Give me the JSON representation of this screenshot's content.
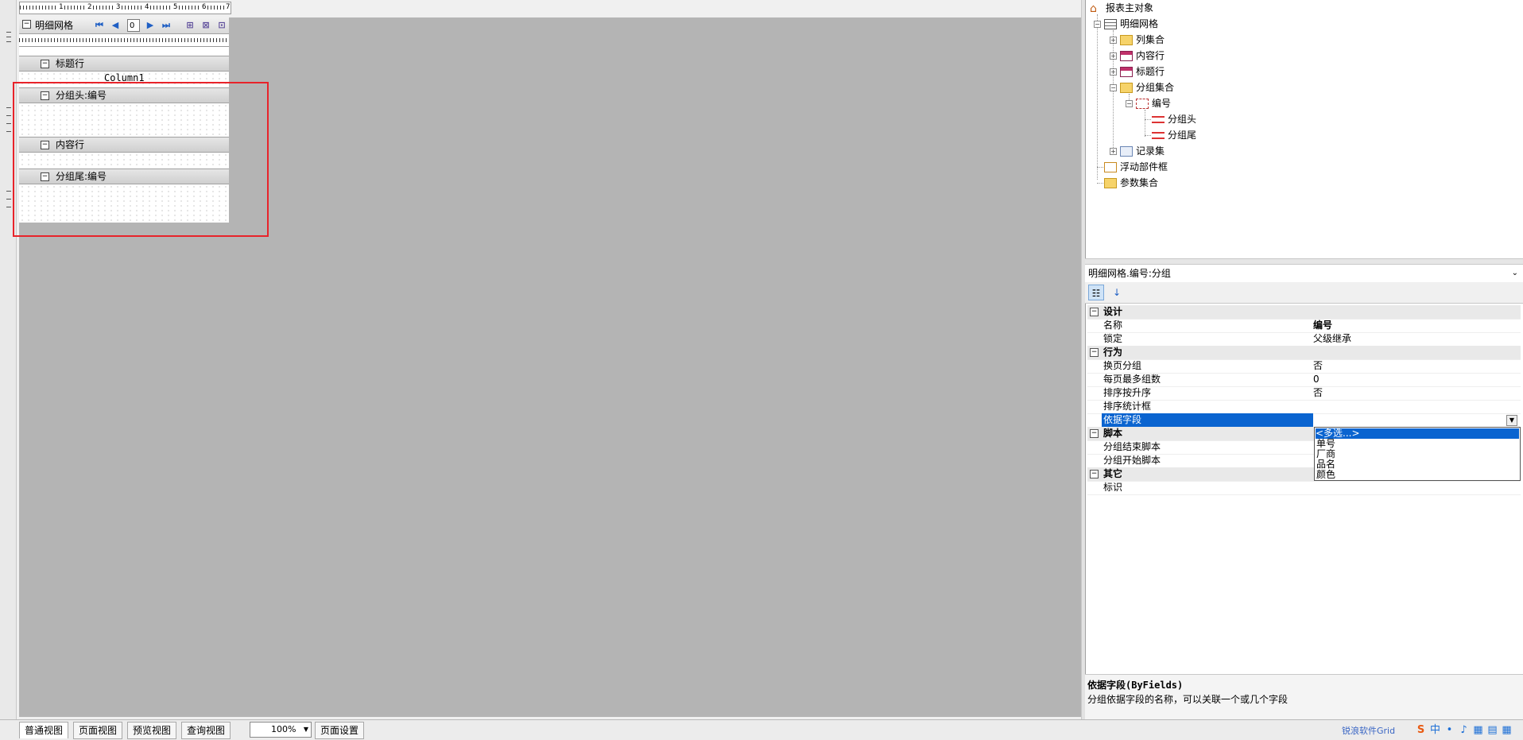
{
  "designer": {
    "ruler_numbers": [
      "1",
      "2",
      "3",
      "4",
      "5",
      "6",
      "7"
    ],
    "grid_toolbar": {
      "title": "明细网格",
      "page_value": "0",
      "collapse_glyph": "⊟",
      "nav_icons": [
        "first-page-icon",
        "prev-page-icon",
        "next-page-icon",
        "last-page-icon"
      ],
      "tool_icons": [
        "grid-tool-icon-1",
        "grid-tool-icon-2",
        "grid-tool-icon-3"
      ]
    },
    "bands": [
      {
        "label": "标题行",
        "content": "Column1"
      },
      {
        "label": "分组头:编号",
        "content": ""
      },
      {
        "label": "内容行",
        "content": ""
      },
      {
        "label": "分组尾:编号",
        "content": ""
      }
    ],
    "highlight_color": "#e8232a"
  },
  "tree": {
    "root": "报表主对象",
    "items": [
      {
        "label": "明细网格",
        "icon": "grid-icon",
        "expander": "−"
      },
      {
        "label": "列集合",
        "icon": "folder-icon",
        "expander": "+"
      },
      {
        "label": "内容行",
        "icon": "content-row-icon",
        "expander": "+"
      },
      {
        "label": "标题行",
        "icon": "title-row-icon",
        "expander": "+"
      },
      {
        "label": "分组集合",
        "icon": "folder-icon",
        "expander": "−"
      },
      {
        "label": "编号",
        "icon": "group-icon",
        "expander": "−"
      },
      {
        "label": "分组头",
        "icon": "group-header-icon",
        "expander": ""
      },
      {
        "label": "分组尾",
        "icon": "group-footer-icon",
        "expander": ""
      },
      {
        "label": "记录集",
        "icon": "recordset-icon",
        "expander": "+"
      },
      {
        "label": "浮动部件框",
        "icon": "floating-frame-icon",
        "expander": ""
      },
      {
        "label": "参数集合",
        "icon": "folder-icon",
        "expander": ""
      }
    ]
  },
  "properties": {
    "title": "明细网格.编号:分组",
    "toolbar": {
      "categorized_icon": "categorized-icon",
      "alphabetical_icon": "sort-az-icon"
    },
    "categories": [
      {
        "name": "设计",
        "rows": [
          {
            "name": "名称",
            "value": "编号"
          },
          {
            "name": "锁定",
            "value": "父级继承"
          }
        ]
      },
      {
        "name": "行为",
        "rows": [
          {
            "name": "换页分组",
            "value": "否"
          },
          {
            "name": "每页最多组数",
            "value": "0"
          },
          {
            "name": "排序按升序",
            "value": "否"
          },
          {
            "name": "排序统计框",
            "value": ""
          },
          {
            "name": "依据字段",
            "value": ""
          }
        ]
      },
      {
        "name": "脚本",
        "rows": [
          {
            "name": "分组结束脚本",
            "value": ""
          },
          {
            "name": "分组开始脚本",
            "value": ""
          }
        ]
      },
      {
        "name": "其它",
        "rows": [
          {
            "name": "标识",
            "value": ""
          }
        ]
      }
    ],
    "dropdown_options": [
      "<多选...>",
      "单号",
      "厂商",
      "品名",
      "颜色"
    ],
    "selected_color": "#0a64d0",
    "description": {
      "title": "依据字段(ByFields)",
      "text": "分组依据字段的名称，可以关联一个或几个字段"
    }
  },
  "bottom_bar": {
    "tabs": [
      "普通视图",
      "页面视图",
      "预览视图",
      "查询视图"
    ],
    "zoom": "100%",
    "page_setup": "页面设置",
    "tray_text": "锐浪软件Grid"
  }
}
